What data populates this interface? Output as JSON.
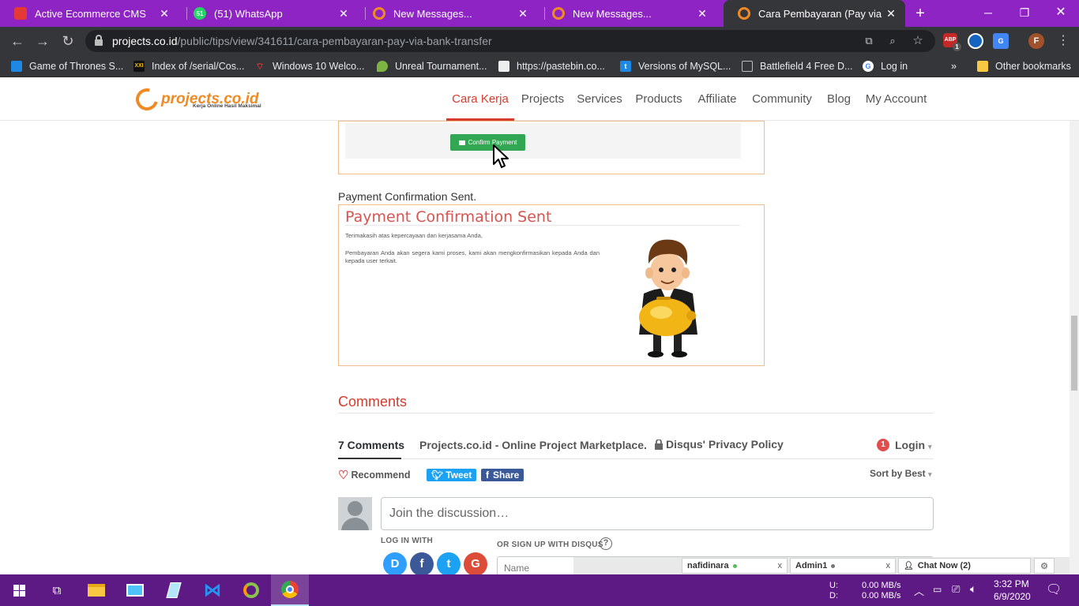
{
  "browser": {
    "tabs": [
      {
        "title": "Active Ecommerce CMS",
        "icon": "red-puzzle-icon",
        "color": "#e53935"
      },
      {
        "title": "(51) WhatsApp",
        "icon": "whatsapp-icon",
        "color": "#25d366",
        "badge": "51"
      },
      {
        "title": "New Messages...",
        "icon": "projects-logo-icon",
        "color": "#f08a24"
      },
      {
        "title": "New Messages...",
        "icon": "projects-logo-icon",
        "color": "#f08a24"
      },
      {
        "title": "Cara Pembayaran (Pay via Bank",
        "icon": "projects-logo-icon",
        "color": "#f08a24"
      }
    ],
    "url_domain": "projects.co.id",
    "url_path": "/public/tips/view/341611/cara-pembayaran-pay-via-bank-transfer",
    "profile_initial": "F",
    "ext_badge": "1",
    "ext_abp_label": "ABP",
    "bookmarks": [
      {
        "label": "Game of Thrones S...",
        "icon": "tv-icon",
        "color": "#1e88e5"
      },
      {
        "label": "Index of /serial/Cos...",
        "icon": "xxi-icon",
        "color": "#111111"
      },
      {
        "label": "Windows 10 Welco...",
        "icon": "wifi-icon",
        "color": "#e53935"
      },
      {
        "label": "Unreal Tournament...",
        "icon": "flame-icon",
        "color": "#7cb342"
      },
      {
        "label": "https://pastebin.co...",
        "icon": "pastebin-icon",
        "color": "#eeeeee"
      },
      {
        "label": "Versions of MySQL...",
        "icon": "t-icon",
        "color": "#1e88e5"
      },
      {
        "label": "Battlefield 4 Free D...",
        "icon": "page-icon",
        "color": "#bdbdbd"
      },
      {
        "label": "Log in",
        "icon": "google-icon",
        "color": "#ffffff"
      }
    ],
    "other_bookmarks": "Other bookmarks"
  },
  "site": {
    "logo_text": "projects.co.id",
    "logo_tagline": "Kerja Online Hasil Maksimal",
    "nav": [
      "Cara Kerja",
      "Projects",
      "Services",
      "Products",
      "Affiliate",
      "Community",
      "Blog",
      "My Account"
    ],
    "active_nav": "Cara Kerja"
  },
  "content": {
    "confirm_button": "Confirm Payment",
    "caption": "Payment Confirmation Sent.",
    "pc_title": "Payment Confirmation Sent",
    "pc_line1": "Terimakasih atas kepercayaan dan kerjasama Anda,",
    "pc_line2": "Pembayaran Anda akan segera kami proses, kami akan mengkonfirmasikan kepada Anda dan kepada user terkait."
  },
  "comments": {
    "heading": "Comments",
    "count_tab": "7 Comments",
    "site_name": "Projects.co.id - Online Project Marketplace.",
    "privacy": "Disqus' Privacy Policy",
    "notifications": "1",
    "login": "Login",
    "recommend": "Recommend",
    "tweet": "Tweet",
    "share": "Share",
    "sort": "Sort by Best",
    "input_placeholder": "Join the discussion…",
    "log_in_with": "LOG IN WITH",
    "or_sign_up": "OR SIGN UP WITH DISQUS",
    "help_glyph": "?",
    "name_placeholder": "Name",
    "social": [
      {
        "icon": "disqus-icon",
        "label": "D",
        "color": "#2e9fff"
      },
      {
        "icon": "facebook-icon",
        "label": "f",
        "color": "#3b5998"
      },
      {
        "icon": "twitter-icon",
        "label": "t",
        "color": "#1da1f2"
      },
      {
        "icon": "google-icon",
        "label": "G",
        "color": "#dd4b39"
      }
    ]
  },
  "chat": {
    "windows": [
      {
        "name": "nafidinara",
        "status_color": "#5cb85c"
      },
      {
        "name": "Admin1",
        "status_color": "#777777"
      }
    ],
    "chat_now": "Chat Now (2)"
  },
  "taskbar": {
    "upload_label": "U:",
    "download_label": "D:",
    "upload_speed": "0.00 MB/s",
    "download_speed": "0.00 MB/s",
    "time": "3:32 PM",
    "date": "6/9/2020"
  }
}
